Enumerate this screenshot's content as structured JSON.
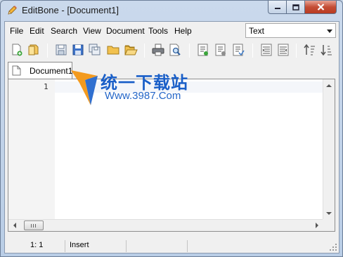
{
  "window": {
    "title": "EditBone - [Document1]",
    "caption_buttons": [
      "minimize",
      "maximize",
      "close"
    ]
  },
  "menu": {
    "items": [
      "File",
      "Edit",
      "Search",
      "View",
      "Document",
      "Tools",
      "Help"
    ]
  },
  "syntax_select": {
    "value": "Text"
  },
  "toolbar": {
    "buttons": [
      "new-document-icon",
      "open-folder-icon",
      "save-icon",
      "save-as-icon",
      "save-all-icon",
      "folder-icon",
      "folder-open-icon",
      "print-icon",
      "print-preview-icon",
      "indent-icon",
      "outdent-icon",
      "toggle-comment-icon",
      "align-left-icon",
      "align-right-icon",
      "sort-ascending-icon",
      "sort-descending-icon"
    ]
  },
  "tabs": [
    {
      "label": "Document1"
    }
  ],
  "editor": {
    "line_numbers": [
      "1"
    ],
    "content": ""
  },
  "statusbar": {
    "position": "1: 1",
    "mode": "Insert"
  },
  "watermark": {
    "chinese": "统一下载站",
    "url": "Www.3987.Com"
  },
  "colors": {
    "title_bar": "#c9d7e9",
    "close_button": "#c44d35",
    "watermark_blue": "#1a5fc8",
    "watermark_orange": "#f39a1e"
  }
}
